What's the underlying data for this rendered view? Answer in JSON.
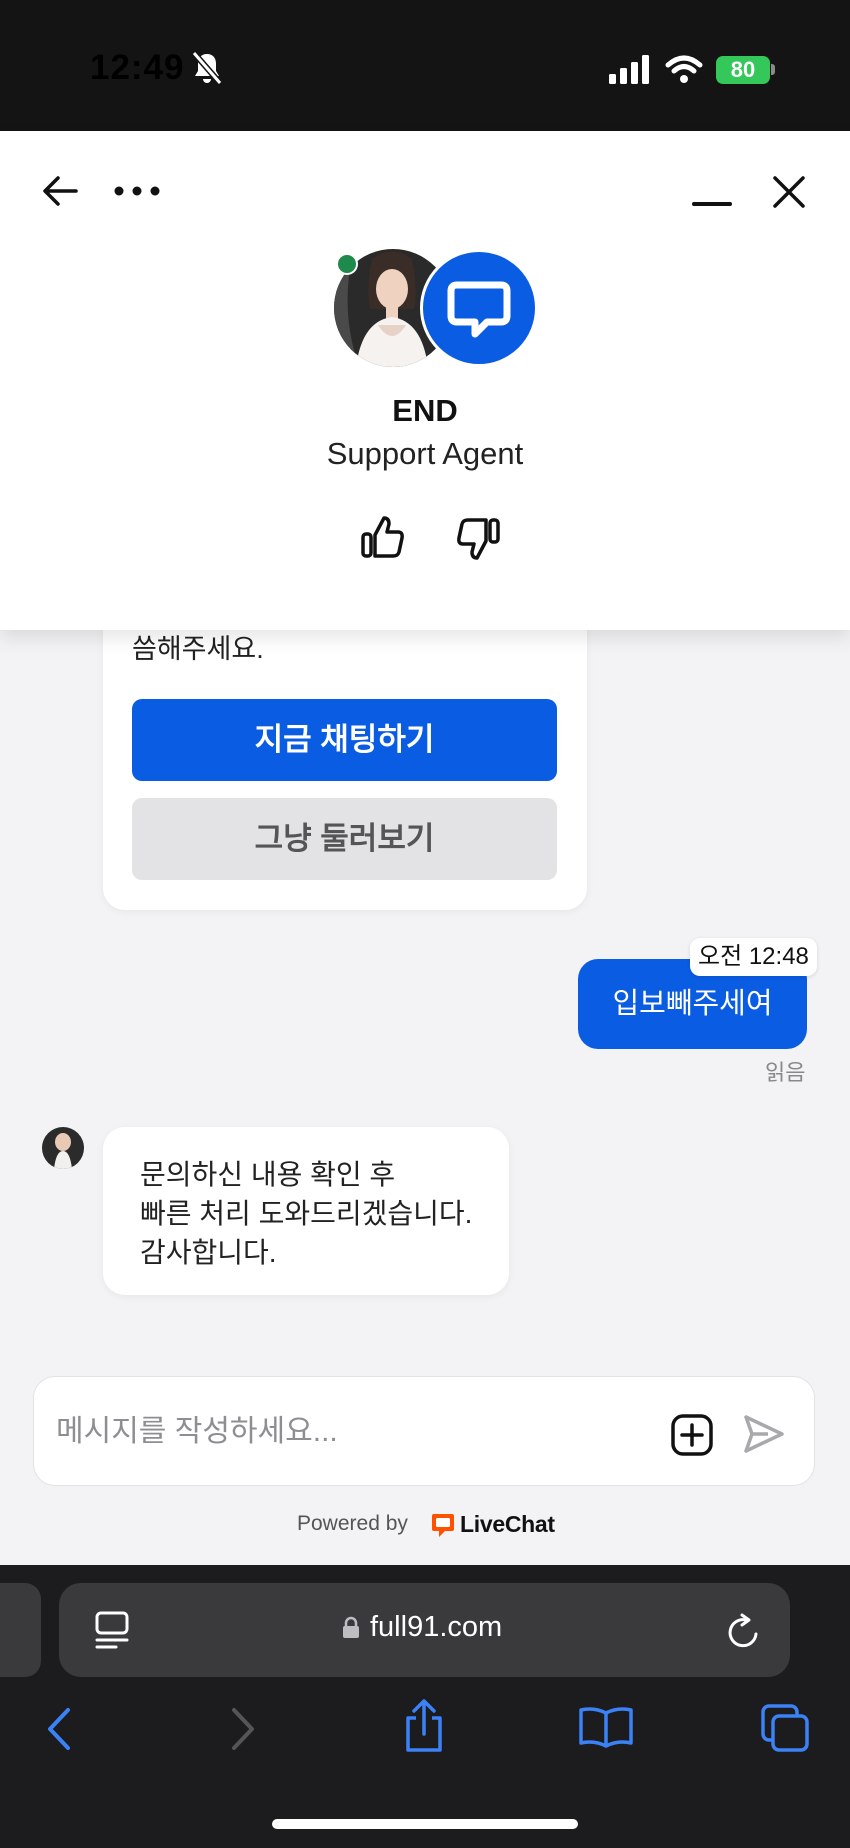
{
  "status_bar": {
    "time": "12:49",
    "battery": "80"
  },
  "header": {
    "agent_name": "END",
    "agent_role": "Support Agent"
  },
  "chat": {
    "card_text_partial": "씀해주세요.",
    "primary_button": "지금 채팅하기",
    "secondary_button": "그냥 둘러보기",
    "user_message": "입보빼주세여",
    "user_message_time": "오전 12:48",
    "read_status": "읽음",
    "agent_reply": {
      "line1": "문의하신 내용 확인 후",
      "line2": "빠른 처리 도와드리겠습니다.",
      "line3": "감사합니다."
    }
  },
  "composer": {
    "placeholder": "메시지를 작성하세요...",
    "powered_by": "Powered by",
    "brand": "LiveChat"
  },
  "browser": {
    "url": "full91.com"
  },
  "colors": {
    "accent": "#0a5ce3",
    "online": "#1e8a4c",
    "livechat_orange": "#ff5100",
    "battery_green": "#34c759"
  }
}
